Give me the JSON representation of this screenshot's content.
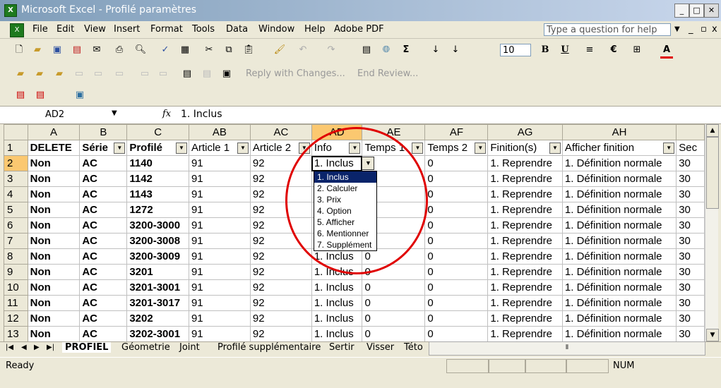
{
  "window": {
    "title": "Microsoft Excel - Profilé paramètres",
    "app_icon": "X"
  },
  "menu": {
    "items": [
      "File",
      "Edit",
      "View",
      "Insert",
      "Format",
      "Tools",
      "Data",
      "Window",
      "Help",
      "Adobe PDF"
    ],
    "help_placeholder": "Type a question for help"
  },
  "toolbar": {
    "font_size": "10",
    "bold": "B",
    "underline": "U",
    "euro": "€",
    "font_color": "A",
    "sigma": "Σ",
    "review": {
      "reply": "Reply with Changes...",
      "end": "End Review..."
    }
  },
  "formula_bar": {
    "name_box": "AD2",
    "fx": "fx",
    "formula": "1. Inclus"
  },
  "sheet": {
    "column_headers": [
      "A",
      "B",
      "C",
      "AB",
      "AC",
      "AD",
      "AE",
      "AF",
      "AG",
      "AH",
      ""
    ],
    "header_row": [
      "DELETE",
      "Série",
      "Profilé",
      "Article 1",
      "Article 2",
      "Info",
      "Temps 1",
      "Temps 2",
      "Finition(s)",
      "Afficher finition",
      "Sec"
    ],
    "rows": [
      {
        "num": "2",
        "c": [
          "Non",
          "AC",
          "1140",
          "91",
          "92",
          "1. Inclus",
          "",
          "0",
          "1. Reprendre",
          "1. Définition normale",
          "30"
        ]
      },
      {
        "num": "3",
        "c": [
          "Non",
          "AC",
          "1142",
          "91",
          "92",
          "",
          "",
          "0",
          "1. Reprendre",
          "1. Définition normale",
          "30"
        ]
      },
      {
        "num": "4",
        "c": [
          "Non",
          "AC",
          "1143",
          "91",
          "92",
          "",
          "",
          "0",
          "1. Reprendre",
          "1. Définition normale",
          "30"
        ]
      },
      {
        "num": "5",
        "c": [
          "Non",
          "AC",
          "1272",
          "91",
          "92",
          "",
          "",
          "0",
          "1. Reprendre",
          "1. Définition normale",
          "30"
        ]
      },
      {
        "num": "6",
        "c": [
          "Non",
          "AC",
          "3200-3000",
          "91",
          "92",
          "",
          "",
          "0",
          "1. Reprendre",
          "1. Définition normale",
          "30"
        ]
      },
      {
        "num": "7",
        "c": [
          "Non",
          "AC",
          "3200-3008",
          "91",
          "92",
          "",
          "",
          "0",
          "1. Reprendre",
          "1. Définition normale",
          "30"
        ]
      },
      {
        "num": "8",
        "c": [
          "Non",
          "AC",
          "3200-3009",
          "91",
          "92",
          "1. Inclus",
          "0",
          "0",
          "1. Reprendre",
          "1. Définition normale",
          "30"
        ]
      },
      {
        "num": "9",
        "c": [
          "Non",
          "AC",
          "3201",
          "91",
          "92",
          "1. Inclus",
          "0",
          "0",
          "1. Reprendre",
          "1. Définition normale",
          "30"
        ]
      },
      {
        "num": "10",
        "c": [
          "Non",
          "AC",
          "3201-3001",
          "91",
          "92",
          "1. Inclus",
          "0",
          "0",
          "1. Reprendre",
          "1. Définition normale",
          "30"
        ]
      },
      {
        "num": "11",
        "c": [
          "Non",
          "AC",
          "3201-3017",
          "91",
          "92",
          "1. Inclus",
          "0",
          "0",
          "1. Reprendre",
          "1. Définition normale",
          "30"
        ]
      },
      {
        "num": "12",
        "c": [
          "Non",
          "AC",
          "3202",
          "91",
          "92",
          "1. Inclus",
          "0",
          "0",
          "1. Reprendre",
          "1. Définition normale",
          "30"
        ]
      },
      {
        "num": "13",
        "c": [
          "Non",
          "AC",
          "3202-3001",
          "91",
          "92",
          "1. Inclus",
          "0",
          "0",
          "1. Reprendre",
          "1. Définition normale",
          "30"
        ]
      }
    ]
  },
  "dropdown": {
    "options": [
      "1. Inclus",
      "2. Calculer",
      "3. Prix",
      "4. Option",
      "5. Afficher",
      "6. Mentionner",
      "7. Supplément"
    ],
    "selected": "1. Inclus"
  },
  "tabs": [
    "PROFIEL",
    "Géometrie",
    "Joint",
    "Profilé supplémentaire",
    "Sertir",
    "Visser",
    "Této"
  ],
  "active_tab": "PROFIEL",
  "status": {
    "ready": "Ready",
    "num": "NUM"
  },
  "colors": {
    "annotation": "#e00000",
    "selected_header": "#fbc870"
  }
}
